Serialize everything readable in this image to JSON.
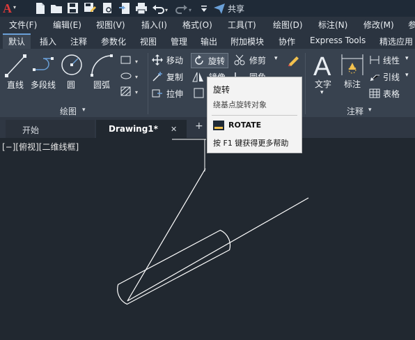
{
  "app_logo": "A",
  "quick_access": {
    "icons": [
      "new-icon",
      "open-icon",
      "save-icon",
      "save-as-icon",
      "print-preview-icon",
      "export-icon",
      "print-icon",
      "undo-icon",
      "redo-icon",
      "dropdown-icon",
      "share-icon"
    ],
    "share_label": "共享"
  },
  "menu": {
    "items": [
      "文件(F)",
      "编辑(E)",
      "视图(V)",
      "插入(I)",
      "格式(O)",
      "工具(T)",
      "绘图(D)",
      "标注(N)",
      "修改(M)",
      "参"
    ]
  },
  "ribbon_tabs": [
    "默认",
    "插入",
    "注释",
    "参数化",
    "视图",
    "管理",
    "输出",
    "附加模块",
    "协作",
    "Express Tools",
    "精选应用"
  ],
  "ribbon": {
    "draw": {
      "tools": [
        "直线",
        "多段线",
        "圆",
        "圆弧"
      ],
      "panel_title": "绘图"
    },
    "modify": {
      "row1": [
        "移动",
        "旋转",
        "修剪"
      ],
      "row2": [
        "复制",
        "镜像",
        "圆角"
      ],
      "row3": [
        "拉伸"
      ]
    },
    "annotation": {
      "tools": [
        "文字",
        "标注"
      ],
      "side": [
        "线性",
        "引线",
        "表格"
      ],
      "panel_title": "注释"
    }
  },
  "doc_tabs": {
    "start": "开始",
    "drawing": "Drawing1*",
    "close": "✕",
    "add": "+"
  },
  "viewport_label": "[−][俯视][二维线框]",
  "tooltip": {
    "title": "旋转",
    "description": "绕基点旋转对象",
    "command": "ROTATE",
    "help": "按 F1 键获得更多帮助"
  },
  "colors": {
    "canvas": "#212830",
    "ribbon": "#38424f",
    "accent": "#6aa0d8",
    "logo": "#d93a3a"
  }
}
